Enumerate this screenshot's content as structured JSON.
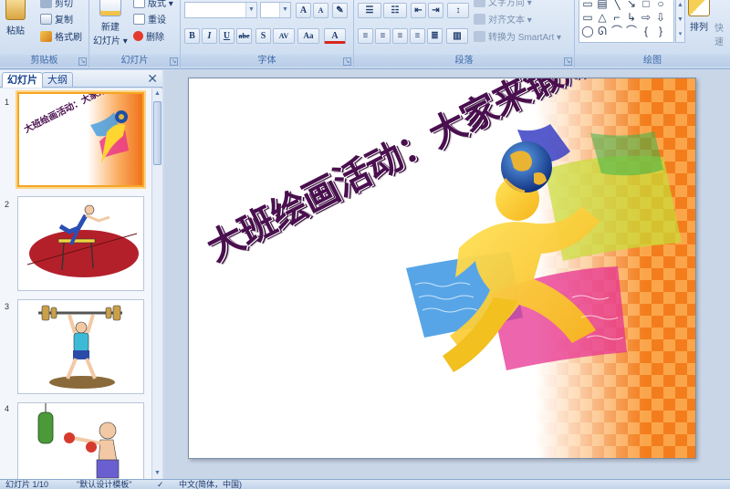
{
  "ribbon": {
    "clipboard": {
      "label": "剪贴板",
      "paste": "粘贴",
      "cut": "剪切",
      "copy": "复制",
      "format_painter": "格式刷"
    },
    "slides": {
      "label": "幻灯片",
      "new_slide_line1": "新建",
      "new_slide_line2": "幻灯片 ▾",
      "layout": "版式 ▾",
      "reset": "重设",
      "delete": "删除"
    },
    "font": {
      "label": "字体",
      "grow": "A",
      "shrink": "A",
      "clear": "✎",
      "bold": "B",
      "italic": "I",
      "underline": "U",
      "strike": "abe",
      "shadow": "S",
      "spacing": "AV",
      "case": "Aa",
      "color": "A"
    },
    "paragraph": {
      "label": "段落",
      "text_direction": "文字方向 ▾",
      "align_text": "对齐文本 ▾",
      "smartart": "转换为 SmartArt ▾"
    },
    "drawing": {
      "label": "绘图",
      "arrange": "排列",
      "quick_styles": "快速"
    }
  },
  "pane": {
    "tab_slides": "幻灯片",
    "tab_outline": "大纲",
    "close": "✕",
    "thumbnails": [
      {
        "num": "1",
        "selected": true,
        "title": "大班绘画活动：大家来锻炼"
      },
      {
        "num": "2",
        "selected": false
      },
      {
        "num": "3",
        "selected": false
      },
      {
        "num": "4",
        "selected": false
      }
    ]
  },
  "slide": {
    "title": "大班绘画活动：大家来锻炼"
  },
  "status": {
    "slide_count": "幻灯片 1/10",
    "theme": "\"默认设计模板\"",
    "language": "中文(简体，中国)"
  }
}
